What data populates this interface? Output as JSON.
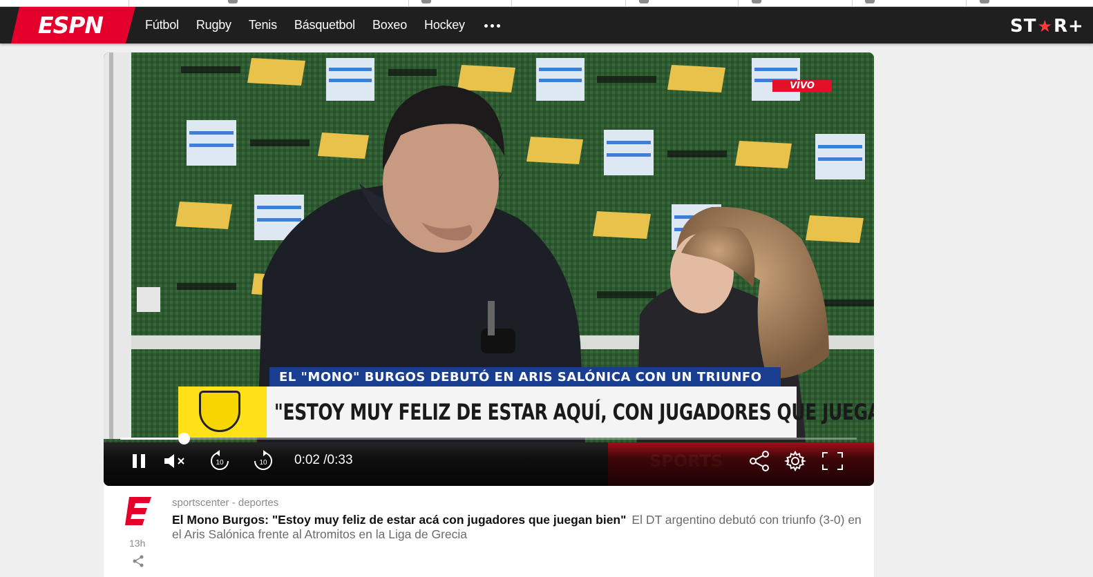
{
  "nav": {
    "brand": "ESPN",
    "items": [
      {
        "label": "Fútbol"
      },
      {
        "label": "Rugby"
      },
      {
        "label": "Tenis"
      },
      {
        "label": "Básquetbol"
      },
      {
        "label": "Boxeo"
      },
      {
        "label": "Hockey"
      }
    ],
    "more_icon": "more-dots-icon",
    "partner": {
      "text_left": "ST",
      "star": "★",
      "text_right": "R+"
    }
  },
  "player": {
    "live_badge": "VIVO",
    "lower_third_strip": "EL \"MONO\" BURGOS DEBUTÓ EN ARIS SALÓNICA CON UN TRIUNFO",
    "lower_third_quote": "\"ESTOY MUY FELIZ DE ESTAR AQUÍ, CON JUGADORES QUE JUEGAN BIEN\"",
    "current_time": "0:02",
    "time_separator": "/",
    "duration": "0:33",
    "progress_fraction": 0.086,
    "icons": {
      "pause": "pause-icon",
      "mute": "volume-muted-icon",
      "rewind": "rewind-10-icon",
      "forward": "forward-10-icon",
      "share": "share-icon",
      "settings": "settings-gear-icon",
      "fullscreen": "fullscreen-icon"
    },
    "skip_seconds": "10"
  },
  "article": {
    "source": "sportscenter - deportes",
    "title": "El Mono Burgos: \"Estoy muy feliz de estar acá con jugadores que juegan bien\"",
    "summary": "El DT argentino debutó con triunfo (3-0) en el Aris Salónica frente al Atromitos en la Liga de Grecia",
    "time_ago": "13h",
    "logo_icon": "espn-e-logo-icon",
    "share_icon": "share-icon"
  },
  "colors": {
    "espn_red": "#e4002b",
    "nav_bg": "#1f1f1f",
    "page_bg": "#efefef",
    "live_red": "#e3102a",
    "strip_blue": "#1a3e8f",
    "badge_yellow": "#ffe11a"
  }
}
